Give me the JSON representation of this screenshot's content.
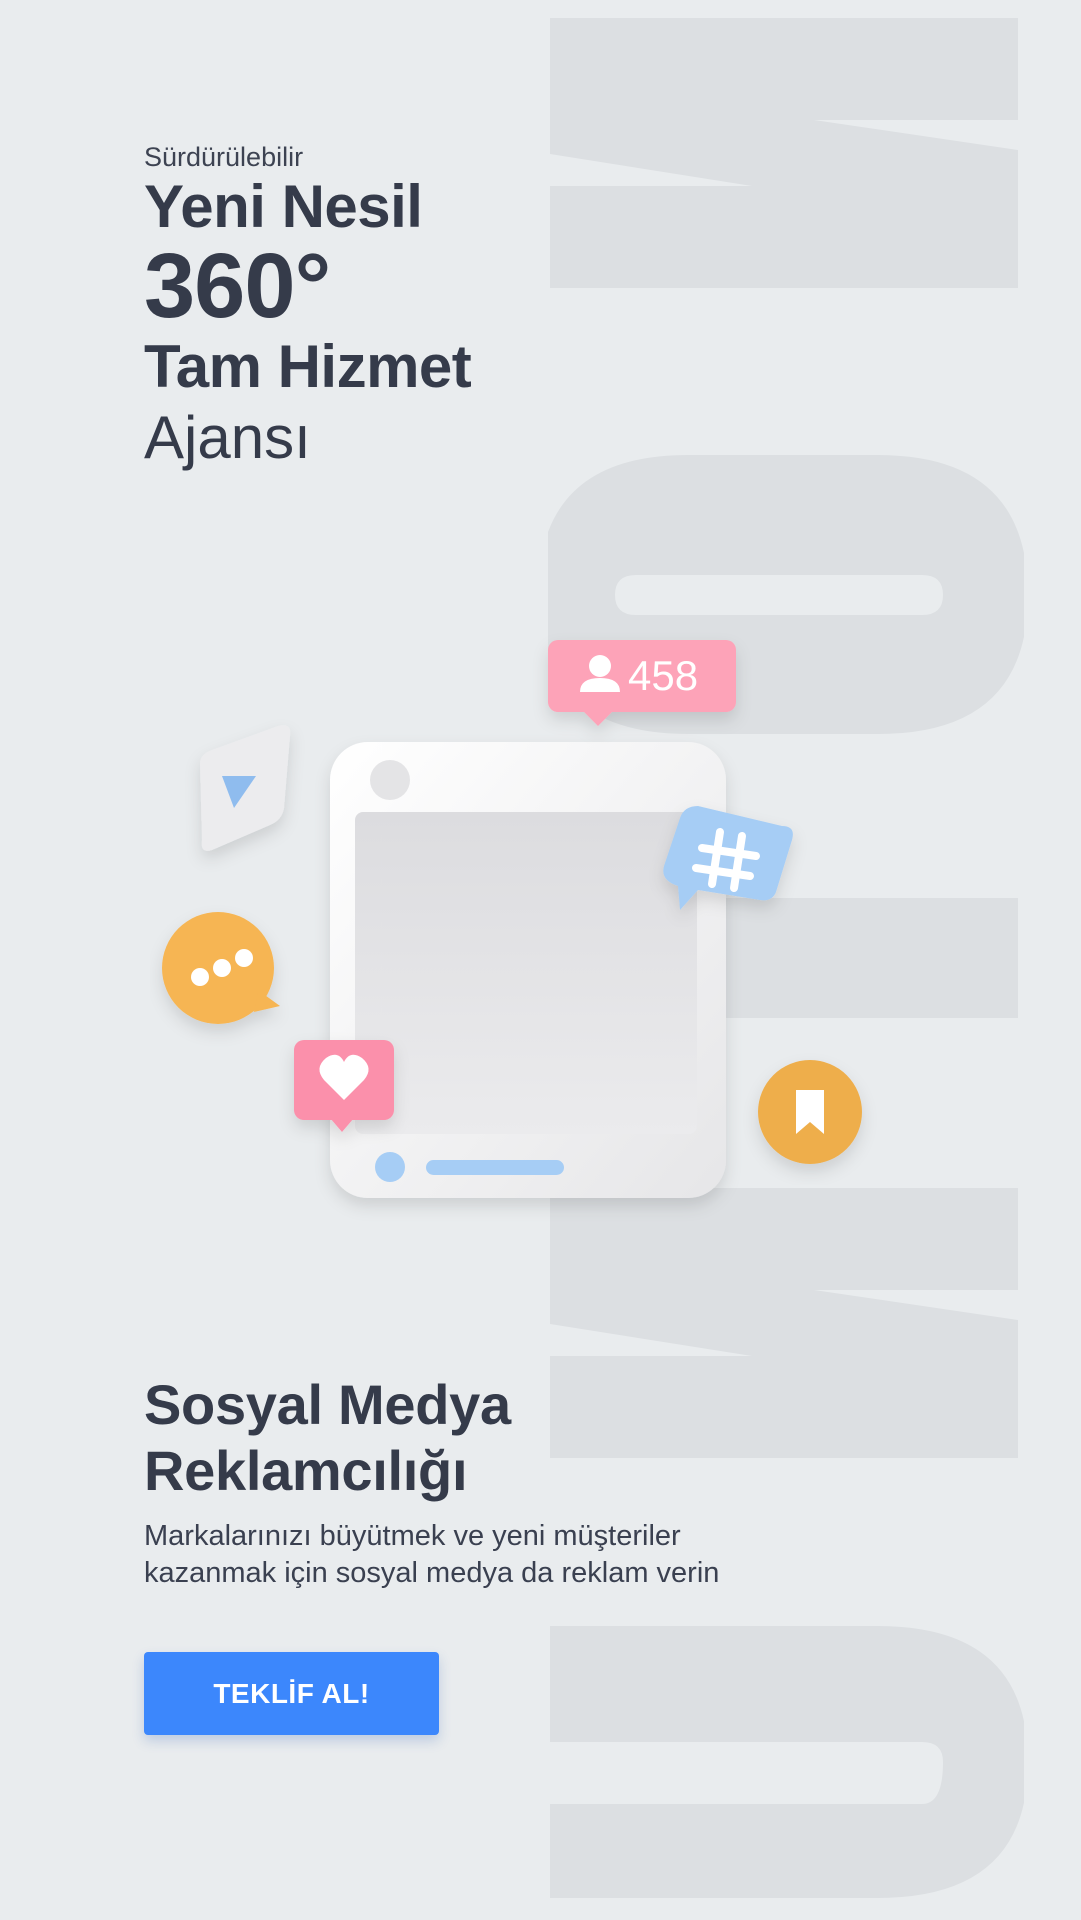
{
  "hero": {
    "eyebrow": "Sürdürülebilir",
    "line1": "Yeni Nesil",
    "line2": "360°",
    "line3": "Tam Hizmet",
    "line4": "Ajansı"
  },
  "illustration": {
    "follower_count": "458",
    "icons": [
      "play-icon",
      "chat-bubble-icon",
      "heart-icon",
      "hashtag-icon",
      "bookmark-icon",
      "user-icon"
    ]
  },
  "section": {
    "title_line1": "Sosyal Medya",
    "title_line2": "Reklamcılığı",
    "desc_line1": "Markalarınızı büyütmek ve yeni müşteriler",
    "desc_line2": "kazanmak için sosyal medya da reklam verin"
  },
  "cta": {
    "label": "TEKLİF AL!"
  },
  "colors": {
    "background": "#e9ecee",
    "text": "#353b4a",
    "accent_blue": "#3c87fc",
    "pink": "#fda3b8",
    "orange": "#f6b553",
    "light_blue": "#a6cdf5"
  }
}
